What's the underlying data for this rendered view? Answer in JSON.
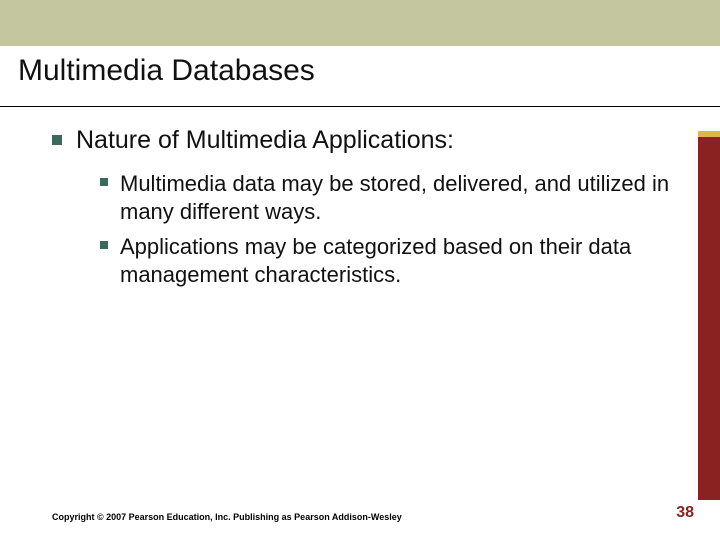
{
  "slide": {
    "title": "Multimedia Databases",
    "heading": "Nature of Multimedia Applications:",
    "bullets": [
      "Multimedia data may be stored, delivered, and utilized in many different ways.",
      "Applications may be categorized based on their data management characteristics."
    ],
    "copyright": "Copyright © 2007 Pearson Education, Inc. Publishing as Pearson Addison-Wesley",
    "page_number": "38"
  }
}
